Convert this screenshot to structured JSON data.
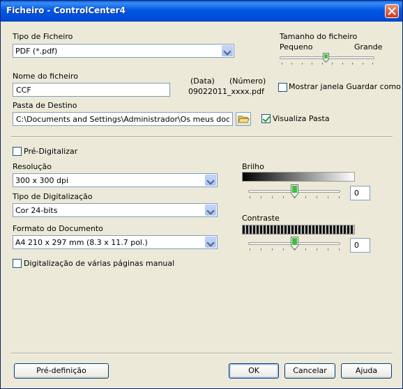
{
  "window": {
    "title": "Ficheiro - ControlCenter4"
  },
  "file_type": {
    "label": "Tipo de Ficheiro",
    "value": "PDF (*.pdf)"
  },
  "file_size": {
    "label": "Tamanho do ficheiro",
    "min_label": "Pequeno",
    "max_label": "Grande",
    "level": 0.55
  },
  "file_name": {
    "label": "Nome do ficheiro",
    "value": "CCF",
    "date_label": "(Data)",
    "number_label": "(Número)",
    "example": "09022011_xxxx.pdf",
    "show_save_as_label": "Mostrar janela Guardar como",
    "show_save_as_checked": false
  },
  "destination": {
    "label": "Pasta de Destino",
    "value": "C:\\Documents and Settings\\Administrador\\Os meus documentos",
    "show_folder_label": "Visualiza Pasta",
    "show_folder_checked": true
  },
  "prescan": {
    "label": "Pré-Digitalizar",
    "checked": false
  },
  "resolution": {
    "label": "Resolução",
    "value": "300 x 300 dpi"
  },
  "scan_type": {
    "label": "Tipo de Digitalização",
    "value": "Cor 24-bits"
  },
  "doc_size": {
    "label": "Formato do Documento",
    "value": "A4 210 x 297 mm (8.3 x 11.7 pol.)"
  },
  "multipage": {
    "label": "Digitalização de várias páginas manual",
    "checked": false
  },
  "brightness": {
    "label": "Brilho",
    "value": "0",
    "level": 0.5
  },
  "contrast": {
    "label": "Contraste",
    "value": "0",
    "level": 0.5
  },
  "buttons": {
    "preset": "Pré-definição",
    "ok": "OK",
    "cancel": "Cancelar",
    "help": "Ajuda"
  },
  "colors": {
    "titlebar": "#0058e6",
    "dialog_bg": "#ece9d8",
    "close": "#cc3a1c"
  }
}
